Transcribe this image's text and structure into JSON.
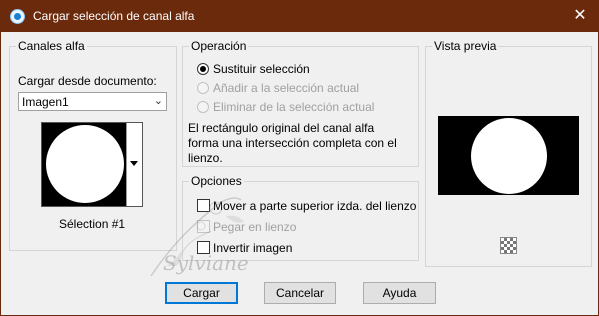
{
  "window": {
    "title": "Cargar selección de canal alfa",
    "close_glyph": "✕"
  },
  "canales": {
    "group_label": "Canales alfa",
    "load_from_label": "Cargar desde documento:",
    "document_select": {
      "value": "Imagen1"
    },
    "selection_name": "Sélection #1"
  },
  "operacion": {
    "group_label": "Operación",
    "options": [
      {
        "label": "Sustituir selección",
        "checked": true,
        "enabled": true
      },
      {
        "label": "Añadir a la selección actual",
        "checked": false,
        "enabled": false
      },
      {
        "label": "Eliminar de la selección actual",
        "checked": false,
        "enabled": false
      }
    ],
    "description": "El rectángulo original del canal alfa forma una intersección completa con el lienzo."
  },
  "opciones": {
    "group_label": "Opciones",
    "checks": [
      {
        "label": "Mover a parte superior izda. del lienzo",
        "checked": false,
        "enabled": true
      },
      {
        "label": "Pegar en lienzo",
        "checked": false,
        "enabled": false
      },
      {
        "label": "Invertir imagen",
        "checked": false,
        "enabled": true
      }
    ]
  },
  "vista": {
    "group_label": "Vista previa",
    "checker_icon": "transparency-checker-icon"
  },
  "buttons": {
    "load": "Cargar",
    "cancel": "Cancelar",
    "help": "Ayuda"
  },
  "watermark": {
    "text": "Sylviane"
  },
  "colors": {
    "titlebar": "#6b2a0c",
    "dialog_bg": "#f0f0f0",
    "default_button_border": "#0078d7"
  }
}
